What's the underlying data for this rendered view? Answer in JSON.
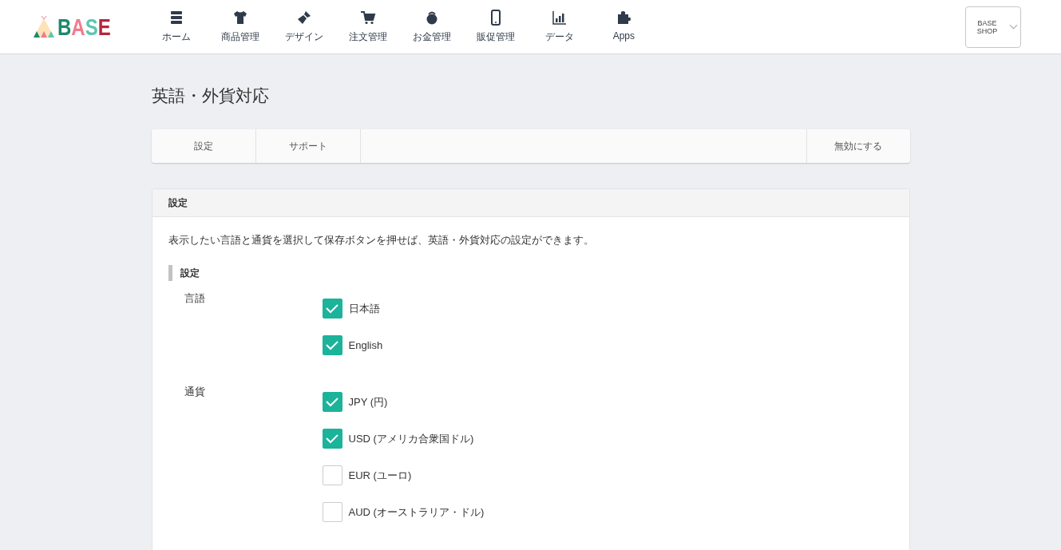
{
  "header": {
    "logo": "BASE",
    "nav": [
      {
        "label": "ホーム"
      },
      {
        "label": "商品管理"
      },
      {
        "label": "デザイン"
      },
      {
        "label": "注文管理"
      },
      {
        "label": "お金管理"
      },
      {
        "label": "販促管理"
      },
      {
        "label": "データ"
      },
      {
        "label": "Apps"
      }
    ],
    "shop": "BASE SHOP"
  },
  "page_title": "英語・外貨対応",
  "tabs": [
    {
      "label": "設定"
    },
    {
      "label": "サポート"
    }
  ],
  "disable_button": "無効にする",
  "card": {
    "title": "設定",
    "description": "表示したい言語と通貨を選択して保存ボタンを押せば、英語・外貨対応の設定ができます。",
    "section": "設定",
    "groups": [
      {
        "label": "言語",
        "options": [
          {
            "label": "日本語",
            "checked": true
          },
          {
            "label": "English",
            "checked": true
          }
        ]
      },
      {
        "label": "通貨",
        "options": [
          {
            "label": "JPY (円)",
            "checked": true
          },
          {
            "label": "USD (アメリカ合衆国ドル)",
            "checked": true
          },
          {
            "label": "EUR (ユーロ)",
            "checked": false
          },
          {
            "label": "AUD (オーストラリア・ドル)",
            "checked": false
          }
        ]
      }
    ]
  }
}
